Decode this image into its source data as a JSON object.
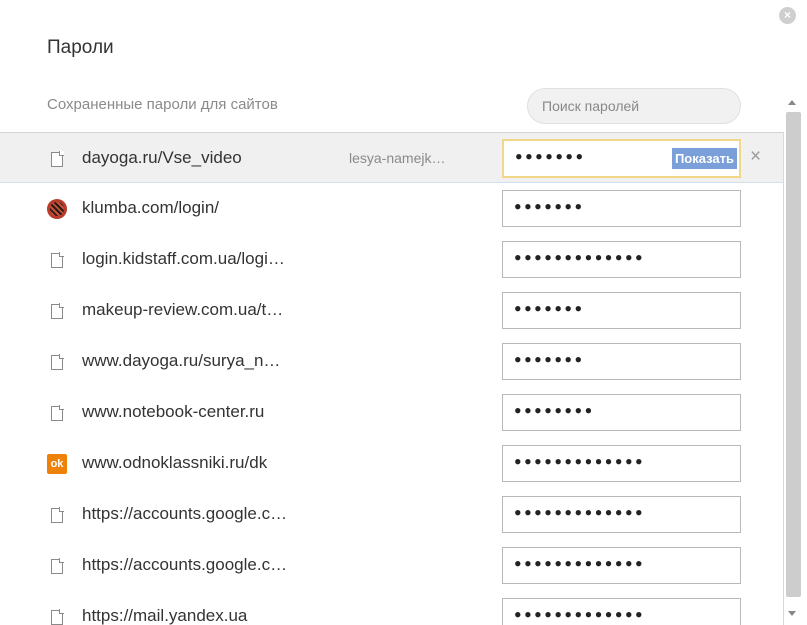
{
  "dialog": {
    "title": "Пароли",
    "subtitle": "Сохраненные пароли для сайтов",
    "close_label": "×"
  },
  "search": {
    "placeholder": "Поиск паролей",
    "value": ""
  },
  "passwords": [
    {
      "site": "dayoga.ru/Vse_video",
      "user": "lesya-namejk…",
      "mask": "•••••••",
      "icon": "document-icon",
      "selected": true,
      "show_label": "Показать",
      "remove_label": "×"
    },
    {
      "site": "klumba.com/login/",
      "user": "",
      "mask": "•••••••",
      "icon": "klumba-icon"
    },
    {
      "site": "login.kidstaff.com.ua/logi…",
      "user": "",
      "mask": "•••••••••••••",
      "icon": "document-icon"
    },
    {
      "site": "makeup-review.com.ua/t…",
      "user": "",
      "mask": "•••••••",
      "icon": "document-icon"
    },
    {
      "site": "www.dayoga.ru/surya_n…",
      "user": "",
      "mask": "•••••••",
      "icon": "document-icon"
    },
    {
      "site": "www.notebook-center.ru",
      "user": "",
      "mask": "••••••••",
      "icon": "document-icon"
    },
    {
      "site": "www.odnoklassniki.ru/dk",
      "user": "",
      "mask": "•••••••••••••",
      "icon": "odnoklassniki-icon"
    },
    {
      "site": "https://accounts.google.c…",
      "user": "",
      "mask": "•••••••••••••",
      "icon": "document-icon"
    },
    {
      "site": "https://accounts.google.c…",
      "user": "",
      "mask": "•••••••••••••",
      "icon": "document-icon"
    },
    {
      "site": "https://mail.yandex.ua",
      "user": "",
      "mask": "•••••••••••••",
      "icon": "document-icon"
    }
  ],
  "colors": {
    "selected_row": "#f0f0f0",
    "show_button": "#7b9fd8",
    "focused_field_border": "#f0d78a",
    "odnoklassniki": "#ee8208"
  }
}
